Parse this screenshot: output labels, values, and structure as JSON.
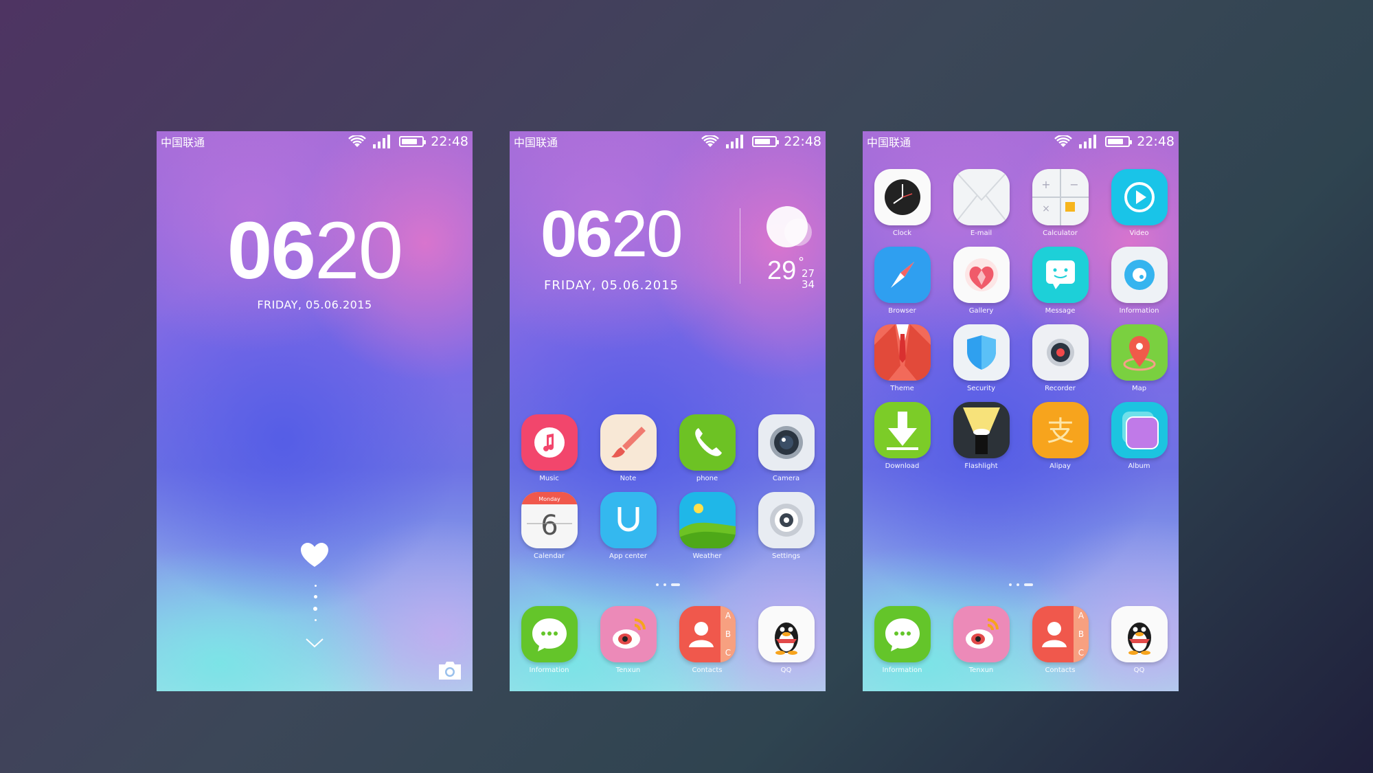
{
  "status": {
    "carrier": "中国联通",
    "time": "22:48"
  },
  "lock": {
    "hours": "06",
    "minutes": "20",
    "date": "FRIDAY, 05.06.2015"
  },
  "home": {
    "clock": {
      "hours": "06",
      "minutes": "20",
      "date": "FRIDAY, 05.06.2015"
    },
    "weather": {
      "temp": "29",
      "degree": "°",
      "high": "27",
      "low": "34"
    },
    "apps": [
      "Music",
      "Note",
      "phone",
      "Camera",
      "Calendar",
      "App center",
      "Weather",
      "Settings"
    ],
    "calendar_day": "Monday",
    "calendar_date": "6",
    "dock": [
      "Information",
      "Tenxun",
      "Contacts",
      "QQ"
    ]
  },
  "drawer": {
    "apps": [
      "Clock",
      "E-mail",
      "Calculator",
      "Video",
      "Browser",
      "Gallery",
      "Message",
      "Information",
      "Theme",
      "Security",
      "Recorder",
      "Map",
      "Download",
      "Flashlight",
      "Alipay",
      "Album"
    ],
    "dock": [
      "Information",
      "Tenxun",
      "Contacts",
      "QQ"
    ]
  },
  "contacts_letters": [
    "A",
    "B",
    "C"
  ],
  "colors": {
    "music": "#f0486a",
    "phone": "#6cc024",
    "message": "#1dd0d8",
    "video": "#19c4e8",
    "map": "#7ad040",
    "alipay": "#f7a41d",
    "information": "#64c52a",
    "contacts": "#f0584c"
  }
}
